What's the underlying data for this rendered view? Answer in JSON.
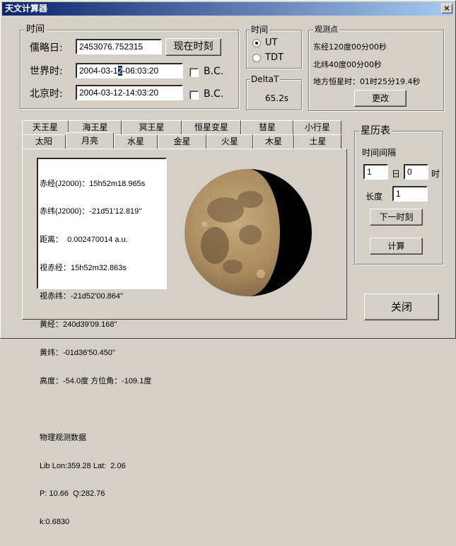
{
  "window": {
    "title": "天文计算器",
    "close_glyph": "×"
  },
  "time_group": {
    "label": "时间",
    "julian_label": "儒略日:",
    "julian_value": "2453076.752315",
    "now_button": "现在时刻",
    "ut_label": "世界时:",
    "ut_value_prefix": "2004-03-1",
    "ut_value_caret": "2",
    "ut_value_suffix": "-06:03:20",
    "bj_label": "北京时:",
    "bj_value": "2004-03-12-14:03:20",
    "bc_label": "B.C."
  },
  "time_system": {
    "label": "时间",
    "ut": "UT",
    "tdt": "TDT",
    "selected": "UT"
  },
  "deltat": {
    "label": "DeltaT",
    "value": "65.2s"
  },
  "observer": {
    "label": "观测点",
    "longitude": "东经120度00分00秒",
    "latitude": "北纬40度00分00秒",
    "sidereal": "地方恒星时：01时25分19.4秒",
    "change_button": "更改"
  },
  "tabs_back": [
    "天王星",
    "海王星",
    "冥王星",
    "恒星变星",
    "彗星",
    "小行星"
  ],
  "tabs_front": [
    "太阳",
    "月亮",
    "水星",
    "金星",
    "火星",
    "木星",
    "土星"
  ],
  "active_tab": "月亮",
  "moon_info": [
    "赤经(J2000)：15h52m18.965s",
    "赤纬(J2000)：-21d51'12.819''",
    "距离：  0.002470014 a.u.",
    "视赤经：15h52m32.863s",
    "视赤纬：-21d52'00.864''",
    "黄经：240d39'09.168''",
    "黄纬：-01d36'50.450''",
    "高度：-54.0度 方位角：-109.1度",
    "",
    "物理观测数据",
    "Lib Lon:359.28 Lat:  2.06",
    "P: 10.66  Q:282.76",
    "k:0.6830"
  ],
  "ephemeris": {
    "label": "星历表",
    "interval_label": "时间间隔",
    "day_value": "1",
    "day_unit": "日",
    "hour_value": "0",
    "hour_unit": "时",
    "length_label": "长度",
    "length_value": "1",
    "next_button": "下一时刻",
    "compute_button": "计算"
  },
  "close_button": "关闭"
}
